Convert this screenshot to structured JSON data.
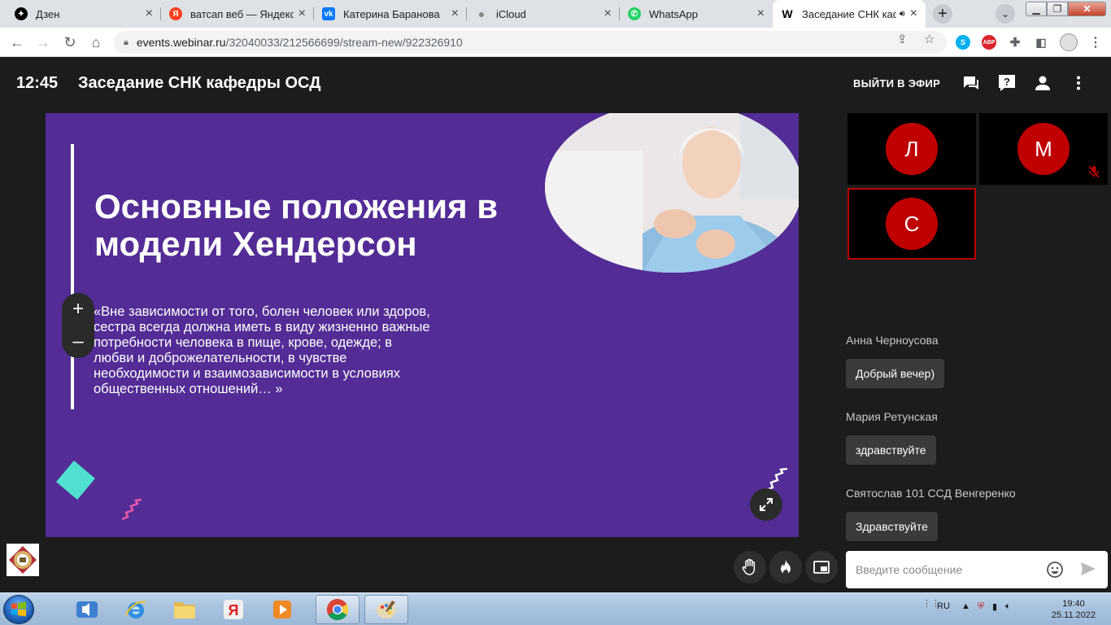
{
  "browser": {
    "tabs": [
      {
        "label": "Дзен",
        "icon": "zen-icon",
        "color": "#000000"
      },
      {
        "label": "ватсап веб — Яндекс: н",
        "icon": "yandex-icon",
        "color": "#fc3f1d"
      },
      {
        "label": "Катерина Баранова",
        "icon": "vk-icon",
        "color": "#0077ff"
      },
      {
        "label": "iCloud",
        "icon": "apple-icon",
        "color": "#9aa0a6"
      },
      {
        "label": "WhatsApp",
        "icon": "whatsapp-icon",
        "color": "#25d366"
      },
      {
        "label": "Заседание СНК каф",
        "icon": "webinar-icon",
        "color": "#000000"
      }
    ],
    "url_host": "events.webinar.ru",
    "url_path": "/32040033/212566699/stream-new/922326910",
    "abp_badge": "ABP"
  },
  "header": {
    "time": "12:45",
    "title": "Заседание СНК кафедры ОСД",
    "go_live": "ВЫЙТИ В ЭФИР"
  },
  "slide": {
    "title": "Основные положения в модели Хендерсон",
    "quote": "«Вне зависимости от того, болен человек или здоров, сестра всегда должна иметь в виду жизненно важные потребности человека в пище, крове, одежде; в любви и доброжелательности, в чувстве необходимости и взаимозависимости в условиях общественных отношений… »",
    "zoom_in": "+",
    "zoom_out": "–"
  },
  "participants": [
    {
      "initial": "Л",
      "muted": false,
      "speaking": false
    },
    {
      "initial": "М",
      "muted": true,
      "speaking": false
    },
    {
      "initial": "С",
      "muted": false,
      "speaking": true
    }
  ],
  "chat": {
    "messages": [
      {
        "author": "Анна Черноусова",
        "text": "Добрый вечер)"
      },
      {
        "author": "Мария Ретунская",
        "text": "здравствуйте"
      },
      {
        "author": "Святослав 101 ССД Венгеренко",
        "text": "Здравствуйте"
      }
    ],
    "input_placeholder": "Введите сообщение"
  },
  "taskbar": {
    "lang": "RU",
    "time": "19:40",
    "date": "25.11.2022",
    "yandex_glyph": "Я"
  },
  "colors": {
    "slide_bg": "#532c96",
    "accent_red": "#c00000",
    "app_bg": "#1c1c1c",
    "teal": "#4fe0cf",
    "pink": "#e85aa8"
  }
}
